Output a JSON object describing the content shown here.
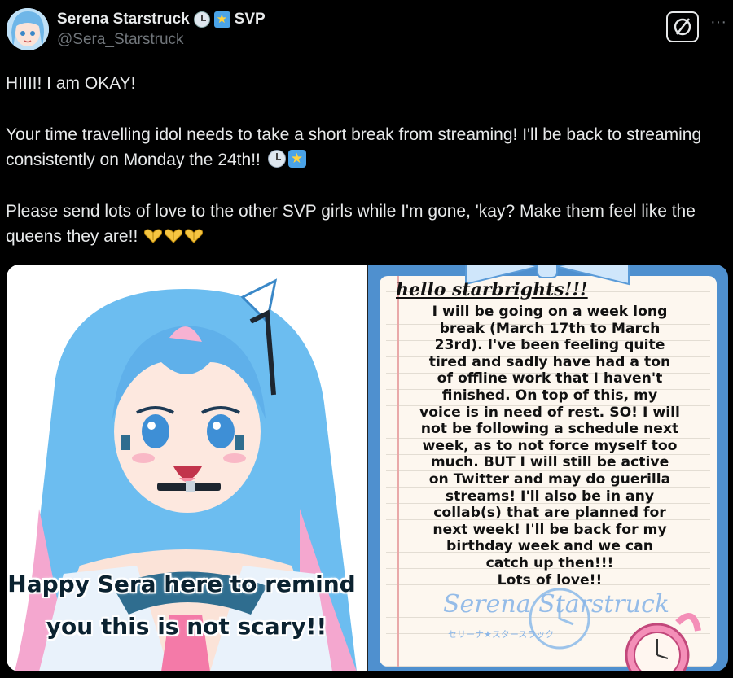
{
  "author": {
    "display_name": "Serena Starstruck",
    "org_label": "SVP",
    "handle": "@Sera_Starstruck"
  },
  "icons": {
    "grok": "grok-slash-circle-icon",
    "more": "more-dots-icon",
    "clock_badge": "clock-emoji-icon",
    "star_badge": "shooting-star-emoji-icon",
    "heart": "heart-hands-emoji-icon"
  },
  "tweet": {
    "line1": "HIIII! I am OKAY!",
    "line2": "Your time travelling idol needs to take a short break from streaming! I'll be back to streaming consistently on Monday the 24th!!",
    "line3": "Please send lots of love to the other SVP girls while I'm gone, 'kay? Make them feel like the queens they are!!"
  },
  "media": {
    "left_caption_1": "Happy Sera here to remind",
    "left_caption_2": "you this is not scary!!",
    "note_title": "hello starbrights!!!",
    "note_lines": [
      "I will be going on a week long",
      "break (March 17th to March",
      "23rd). I've been feeling quite",
      "tired and sadly have had a ton",
      "of offline work that I haven't",
      "finished. On top of this, my",
      "voice is in need of rest. SO! I will",
      "not be following a schedule next",
      "week, as to not force myself too",
      "much. BUT I will still be active",
      "on Twitter and may do guerilla",
      "streams! I'll also be in any",
      "collab(s) that are planned for",
      "next week! I'll be back for my",
      "birthday week and we can",
      "catch up then!!!",
      "Lots of love!!"
    ],
    "signature": "Serena Starstruck",
    "signature_kana": "セリーナ★スタースラック"
  },
  "colors": {
    "background": "#000000",
    "text": "#e7e9ea",
    "muted": "#71767b",
    "note_frame": "#4f90cf",
    "heart": "#f5c542"
  }
}
